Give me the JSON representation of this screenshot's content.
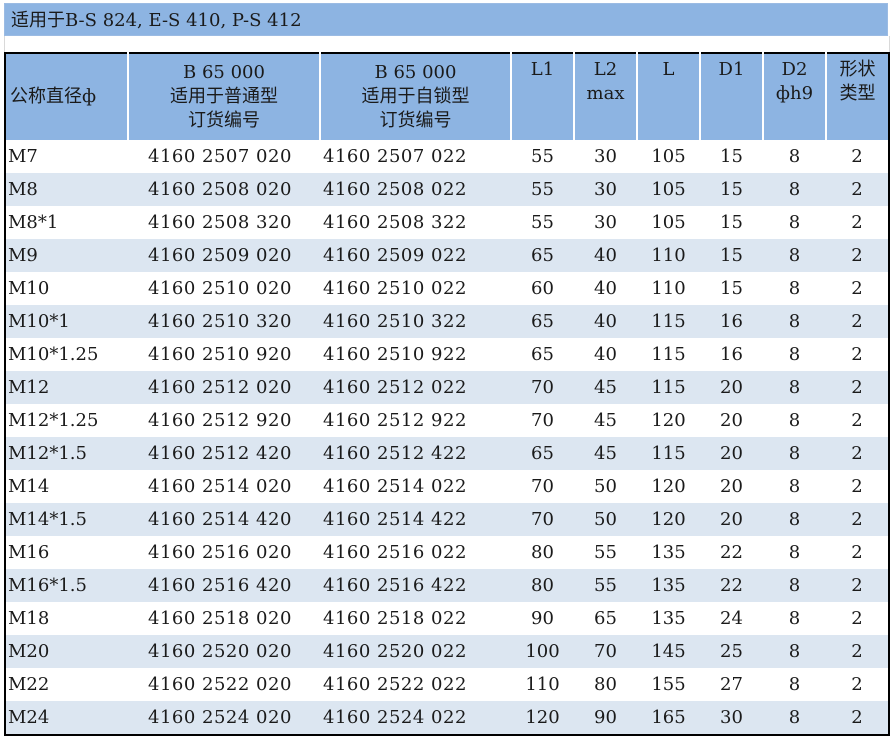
{
  "title": "适用于B-S 824, E-S 410, P-S 412",
  "header": {
    "size": "公称直径ф",
    "standard_lines": [
      "B 65 000",
      "适用于普通型",
      "订货编号"
    ],
    "selflock_lines": [
      "B 65 000",
      "适用于自锁型",
      "订货编号"
    ],
    "l1": "L1",
    "l2_lines": [
      "L2",
      "max"
    ],
    "l": "L",
    "d1": "D1",
    "d2_lines": [
      "D2",
      "фh9"
    ],
    "shape_lines": [
      "形状",
      "类型"
    ]
  },
  "rows": [
    {
      "size": "M7",
      "code_standard": "4160  2507  020",
      "code_selflock": "4160  2507  022",
      "l1": "55",
      "l2": "30",
      "l": "105",
      "d1": "15",
      "d2": "8",
      "shape": "2"
    },
    {
      "size": "M8",
      "code_standard": "4160  2508  020",
      "code_selflock": "4160  2508  022",
      "l1": "55",
      "l2": "30",
      "l": "105",
      "d1": "15",
      "d2": "8",
      "shape": "2"
    },
    {
      "size": "M8*1",
      "code_standard": "4160  2508  320",
      "code_selflock": "4160  2508  322",
      "l1": "55",
      "l2": "30",
      "l": "105",
      "d1": "15",
      "d2": "8",
      "shape": "2"
    },
    {
      "size": "M9",
      "code_standard": "4160  2509  020",
      "code_selflock": "4160  2509  022",
      "l1": "65",
      "l2": "40",
      "l": "110",
      "d1": "15",
      "d2": "8",
      "shape": "2"
    },
    {
      "size": "M10",
      "code_standard": "4160  2510  020",
      "code_selflock": "4160  2510  022",
      "l1": "60",
      "l2": "40",
      "l": "110",
      "d1": "15",
      "d2": "8",
      "shape": "2"
    },
    {
      "size": "M10*1",
      "code_standard": "4160  2510  320",
      "code_selflock": "4160  2510  322",
      "l1": "65",
      "l2": "40",
      "l": "115",
      "d1": "16",
      "d2": "8",
      "shape": "2"
    },
    {
      "size": "M10*1.25",
      "code_standard": "4160  2510  920",
      "code_selflock": "4160  2510  922",
      "l1": "65",
      "l2": "40",
      "l": "115",
      "d1": "16",
      "d2": "8",
      "shape": "2"
    },
    {
      "size": "M12",
      "code_standard": "4160  2512  020",
      "code_selflock": "4160  2512  022",
      "l1": "70",
      "l2": "45",
      "l": "115",
      "d1": "20",
      "d2": "8",
      "shape": "2"
    },
    {
      "size": "M12*1.25",
      "code_standard": "4160  2512  920",
      "code_selflock": "4160  2512  922",
      "l1": "70",
      "l2": "45",
      "l": "120",
      "d1": "20",
      "d2": "8",
      "shape": "2"
    },
    {
      "size": "M12*1.5",
      "code_standard": "4160  2512  420",
      "code_selflock": "4160  2512  422",
      "l1": "65",
      "l2": "45",
      "l": "115",
      "d1": "20",
      "d2": "8",
      "shape": "2"
    },
    {
      "size": "M14",
      "code_standard": "4160  2514  020",
      "code_selflock": "4160  2514  022",
      "l1": "70",
      "l2": "50",
      "l": "120",
      "d1": "20",
      "d2": "8",
      "shape": "2"
    },
    {
      "size": "M14*1.5",
      "code_standard": "4160  2514  420",
      "code_selflock": "4160  2514  422",
      "l1": "70",
      "l2": "50",
      "l": "120",
      "d1": "20",
      "d2": "8",
      "shape": "2"
    },
    {
      "size": "M16",
      "code_standard": "4160  2516  020",
      "code_selflock": "4160  2516  022",
      "l1": "80",
      "l2": "55",
      "l": "135",
      "d1": "22",
      "d2": "8",
      "shape": "2"
    },
    {
      "size": "M16*1.5",
      "code_standard": "4160  2516  420",
      "code_selflock": "4160  2516  422",
      "l1": "80",
      "l2": "55",
      "l": "135",
      "d1": "22",
      "d2": "8",
      "shape": "2"
    },
    {
      "size": "M18",
      "code_standard": "4160  2518  020",
      "code_selflock": "4160  2518  022",
      "l1": "90",
      "l2": "65",
      "l": "135",
      "d1": "24",
      "d2": "8",
      "shape": "2"
    },
    {
      "size": "M20",
      "code_standard": "4160  2520  020",
      "code_selflock": "4160  2520  022",
      "l1": "100",
      "l2": "70",
      "l": "145",
      "d1": "25",
      "d2": "8",
      "shape": "2"
    },
    {
      "size": "M22",
      "code_standard": "4160  2522  020",
      "code_selflock": "4160  2522  022",
      "l1": "110",
      "l2": "80",
      "l": "155",
      "d1": "27",
      "d2": "8",
      "shape": "2"
    },
    {
      "size": "M24",
      "code_standard": "4160  2524  020",
      "code_selflock": "4160  2524  022",
      "l1": "120",
      "l2": "90",
      "l": "165",
      "d1": "30",
      "d2": "8",
      "shape": "2"
    }
  ],
  "colors": {
    "header_bg": "#8db4e2",
    "alt_row_bg": "#dce6f1",
    "border": "#000000"
  }
}
